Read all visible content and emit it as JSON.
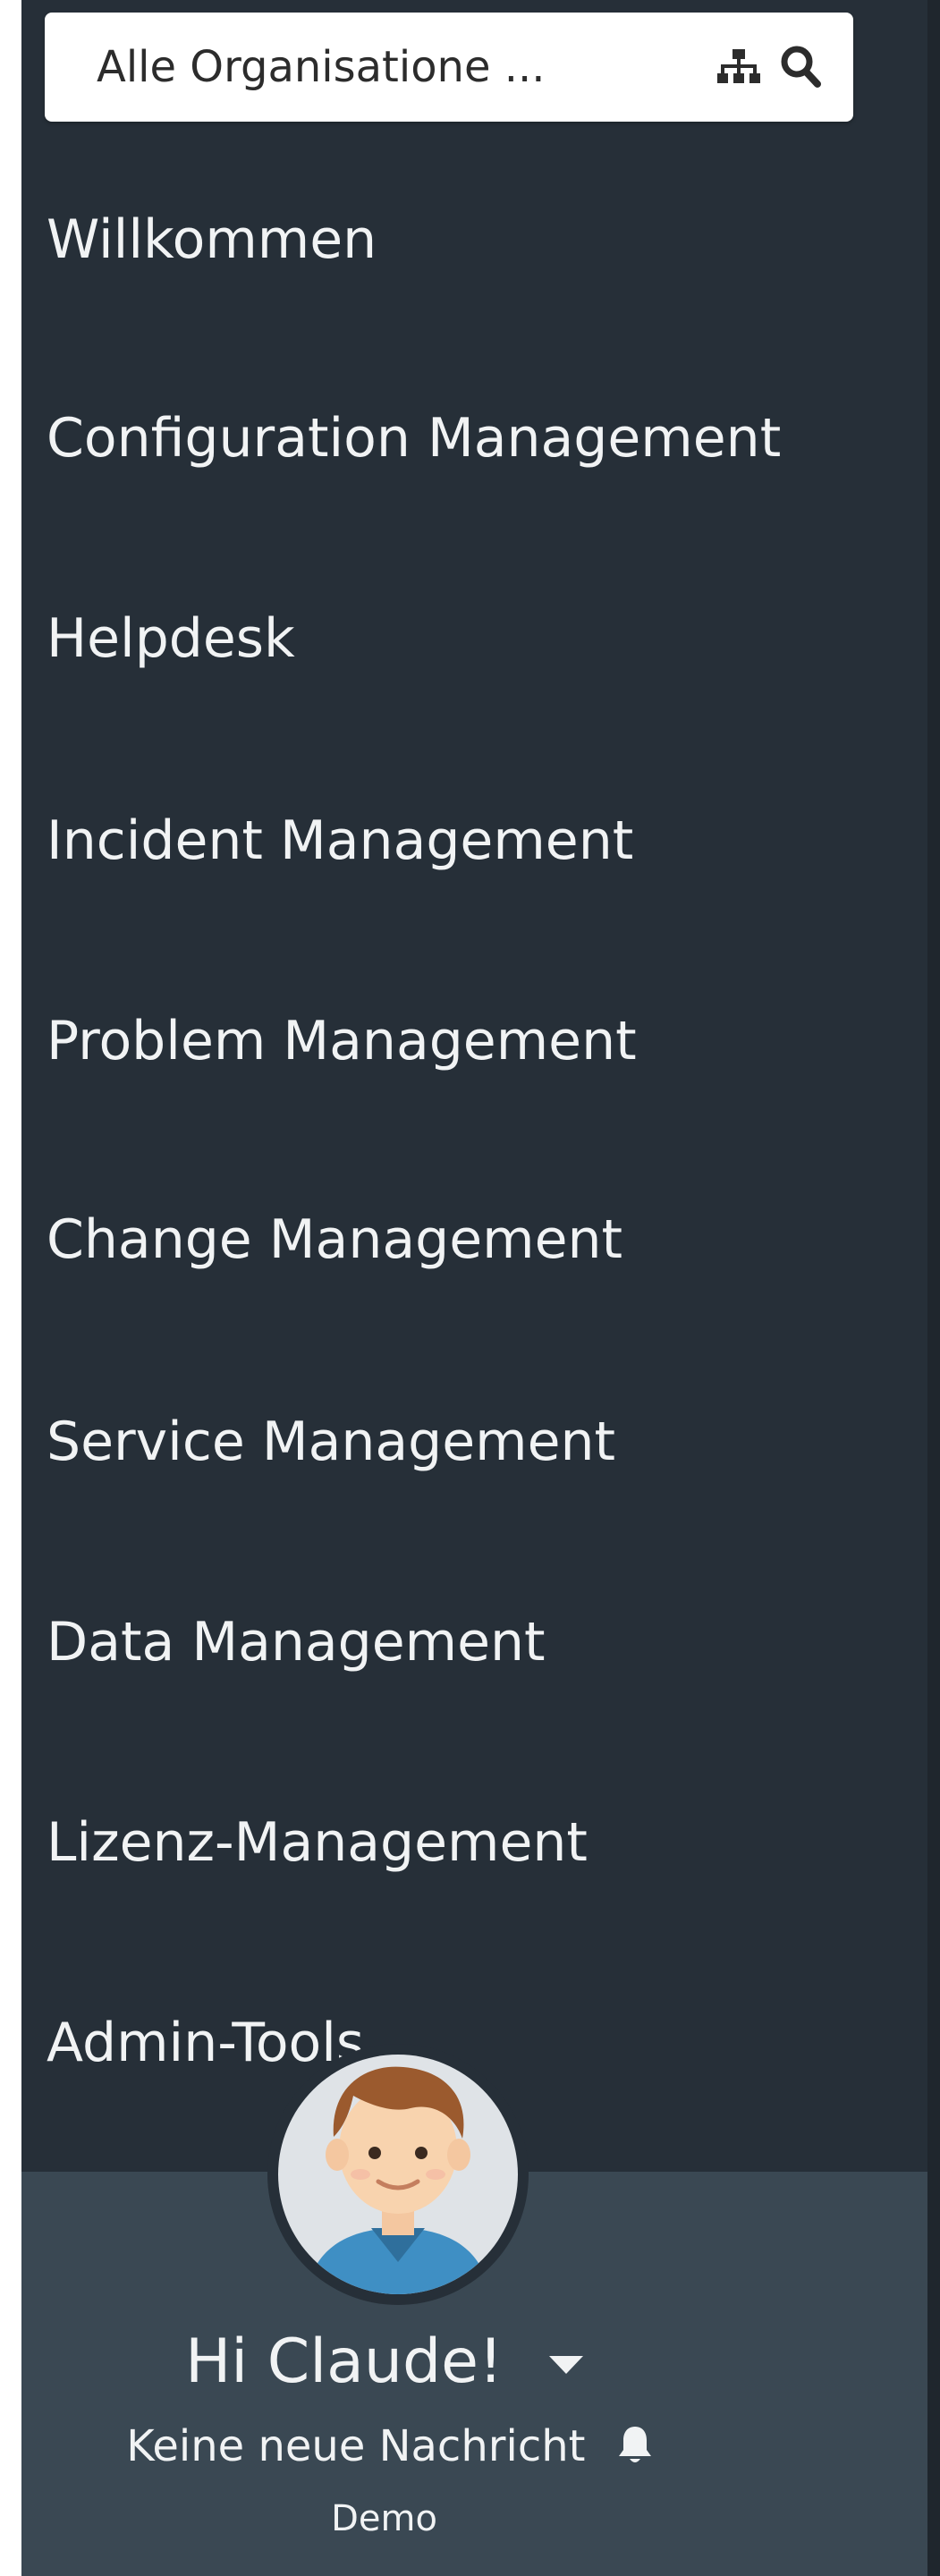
{
  "org_search": {
    "value": "Alle Organisatione ...",
    "tree_icon": "sitemap-icon",
    "search_icon": "search-icon"
  },
  "nav": {
    "items": [
      {
        "label": "Willkommen"
      },
      {
        "label": "Configuration Management"
      },
      {
        "label": "Helpdesk"
      },
      {
        "label": "Incident Management"
      },
      {
        "label": "Problem Management"
      },
      {
        "label": "Change Management"
      },
      {
        "label": "Service Management"
      },
      {
        "label": "Data Management"
      },
      {
        "label": "Lizenz-Management"
      },
      {
        "label": "Admin-Tools"
      }
    ]
  },
  "user": {
    "avatar_icon": "user-avatar-icon",
    "greeting": "Hi Claude!",
    "menu_icon": "caret-down-icon",
    "messages": "Keine neue Nachricht",
    "messages_icon": "bell-icon",
    "tenant": "Demo"
  },
  "colors": {
    "sidebar_bg": "#262f38",
    "user_panel_bg": "#3a4853",
    "text": "#f1f3f4",
    "search_bg": "#ffffff"
  }
}
